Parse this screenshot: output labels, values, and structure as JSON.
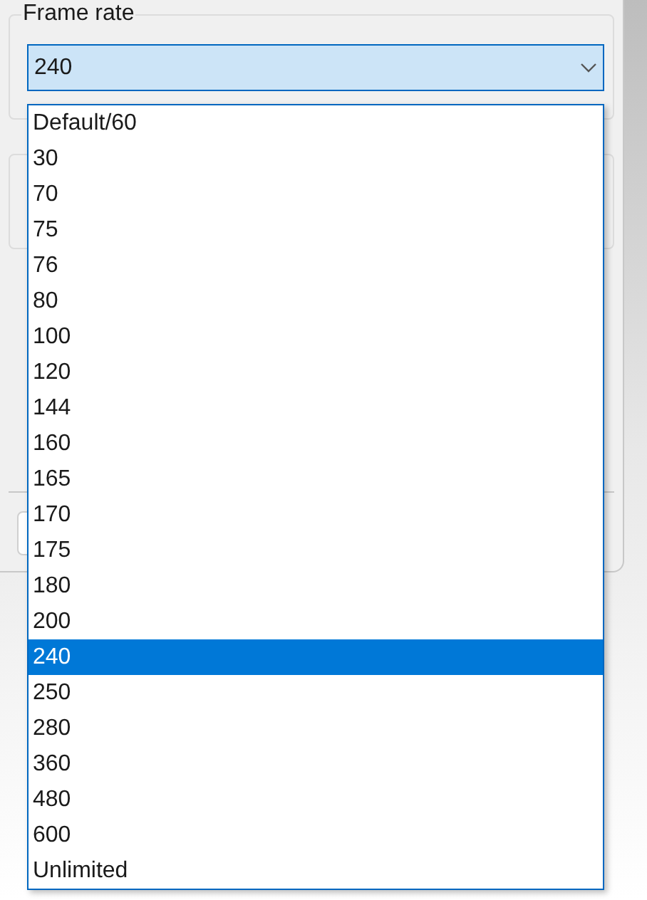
{
  "frame_rate": {
    "label": "Frame rate",
    "value": "240",
    "expanded": true,
    "options": [
      {
        "label": "Default/60",
        "selected": false
      },
      {
        "label": "30",
        "selected": false
      },
      {
        "label": "70",
        "selected": false
      },
      {
        "label": "75",
        "selected": false
      },
      {
        "label": "76",
        "selected": false
      },
      {
        "label": "80",
        "selected": false
      },
      {
        "label": "100",
        "selected": false
      },
      {
        "label": "120",
        "selected": false
      },
      {
        "label": "144",
        "selected": false
      },
      {
        "label": "160",
        "selected": false
      },
      {
        "label": "165",
        "selected": false
      },
      {
        "label": "170",
        "selected": false
      },
      {
        "label": "175",
        "selected": false
      },
      {
        "label": "180",
        "selected": false
      },
      {
        "label": "200",
        "selected": false
      },
      {
        "label": "240",
        "selected": true
      },
      {
        "label": "250",
        "selected": false
      },
      {
        "label": "280",
        "selected": false
      },
      {
        "label": "360",
        "selected": false
      },
      {
        "label": "480",
        "selected": false
      },
      {
        "label": "600",
        "selected": false
      },
      {
        "label": "Unlimited",
        "selected": false
      }
    ]
  }
}
